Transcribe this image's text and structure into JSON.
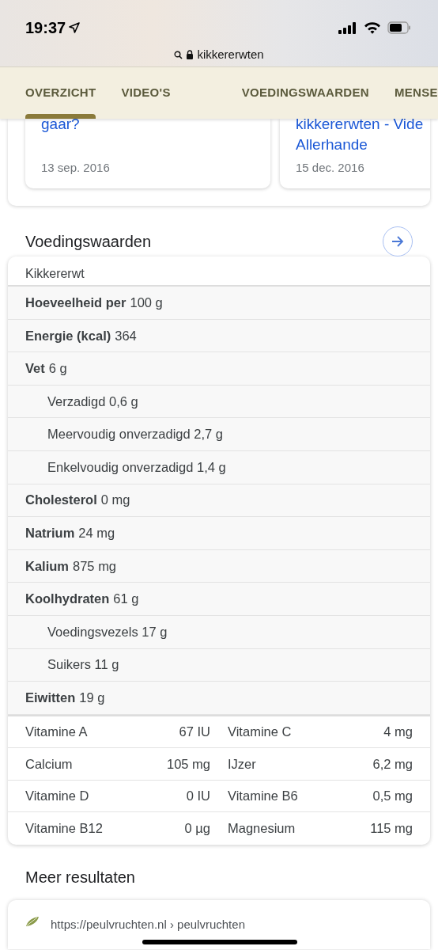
{
  "status_bar": {
    "time": "19:37",
    "url": "kikkererwten"
  },
  "tabs": [
    {
      "label": "OVERZICHT",
      "selected": true
    },
    {
      "label": "VIDEO'S",
      "selected": false
    },
    {
      "label": "VOEDINGSWAARDEN",
      "selected": false
    },
    {
      "label": "MENSE",
      "selected": false
    }
  ],
  "result_cards": [
    {
      "title": "gaar?",
      "date": "13 sep. 2016"
    },
    {
      "title": "kikkererwten - Vide\nAllerhande",
      "date": "15 dec. 2016"
    }
  ],
  "nutrition": {
    "heading": "Voedingswaarden",
    "food": "Kikkererwt",
    "rows": [
      {
        "kind": "main",
        "name": "Hoeveelheid per",
        "value": "100 g"
      },
      {
        "kind": "main",
        "name": "Energie (kcal)",
        "value": "364"
      },
      {
        "kind": "main",
        "name": "Vet",
        "value": "6 g"
      },
      {
        "kind": "sub",
        "name": "Verzadigd",
        "value": "0,6 g"
      },
      {
        "kind": "sub",
        "name": "Meervoudig onverzadigd",
        "value": "2,7 g"
      },
      {
        "kind": "sub",
        "name": "Enkelvoudig onverzadigd",
        "value": "1,4 g"
      },
      {
        "kind": "main",
        "name": "Cholesterol",
        "value": "0 mg"
      },
      {
        "kind": "main",
        "name": "Natrium",
        "value": "24 mg"
      },
      {
        "kind": "main",
        "name": "Kalium",
        "value": "875 mg"
      },
      {
        "kind": "main",
        "name": "Koolhydraten",
        "value": "61 g"
      },
      {
        "kind": "sub",
        "name": "Voedingsvezels",
        "value": "17 g"
      },
      {
        "kind": "sub",
        "name": "Suikers",
        "value": "11 g"
      },
      {
        "kind": "main",
        "name": "Eiwitten",
        "value": "19 g"
      }
    ],
    "vitamins": [
      [
        {
          "name": "Vitamine A",
          "value": "67 IU"
        },
        {
          "name": "Vitamine C",
          "value": "4 mg"
        }
      ],
      [
        {
          "name": "Calcium",
          "value": "105 mg"
        },
        {
          "name": "IJzer",
          "value": "6,2 mg"
        }
      ],
      [
        {
          "name": "Vitamine D",
          "value": "0 IU"
        },
        {
          "name": "Vitamine B6",
          "value": "0,5 mg"
        }
      ],
      [
        {
          "name": "Vitamine B12",
          "value": "0 µg"
        },
        {
          "name": "Magnesium",
          "value": "115 mg"
        }
      ]
    ]
  },
  "more_results": {
    "heading": "Meer resultaten",
    "url": "https://peulvruchten.nl › peulvruchten"
  }
}
